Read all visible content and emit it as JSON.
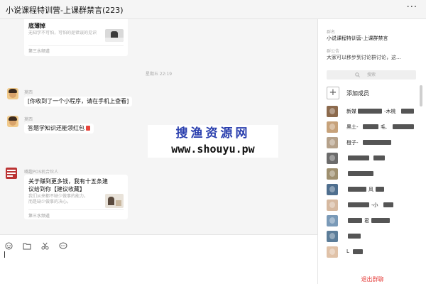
{
  "window": {
    "title": "小说课程特训营-上课群禁言(223)"
  },
  "chat": {
    "card1": {
      "title": "底薄掉",
      "desc": "无知学不可怕，可怕的是错误的见识",
      "source": "第三水频道"
    },
    "timestamp": "星期五 22:19",
    "messages": [
      {
        "sender": "莫西",
        "text": "[你收到了一个小程序，请在手机上查看]"
      },
      {
        "sender": "莫西",
        "text": "答题学知识还能领红包"
      }
    ],
    "card2": {
      "sender": "嘴趣POS机合伙人",
      "title_line1": "关于赚到更多钱，我有十五条建",
      "title_line2": "议给到你【建议收藏】",
      "desc_line1": "我们从来都不缺少做事的能力，",
      "desc_line2": "而是缺少做事的决心。",
      "source": "第三水频道"
    },
    "watermark": {
      "line1": "搜渔资源网",
      "line2": "www.shouyu.pw"
    }
  },
  "toolbar": {
    "emoji_icon": "smile-icon",
    "file_icon": "folder-icon",
    "screenshot_icon": "scissors-icon",
    "chat_icon": "speech-bubble-icon"
  },
  "sidebar": {
    "group_name_label": "群名",
    "group_name": "小说课程特训营-上课群禁言",
    "announcement_label": "群公告",
    "announcement": "大家可以移步到讨论群讨论，这...",
    "search_placeholder": "搜索",
    "add_member_label": "添加成员",
    "members": [
      {
        "name": "新媒",
        "suffix": "-木桃",
        "avatar_color": "#8c6a4d"
      },
      {
        "name": "黑土-",
        "suffix": "毛.",
        "avatar_color": "#c7a27a"
      },
      {
        "name": "橙子-",
        "suffix": "",
        "avatar_color": "#b5a18a"
      },
      {
        "name": "",
        "suffix": "",
        "avatar_color": "#6b6b6b"
      },
      {
        "name": "",
        "suffix": "",
        "avatar_color": "#9e8f6f"
      },
      {
        "name": "",
        "suffix": "风",
        "avatar_color": "#4f6f8f"
      },
      {
        "name": "",
        "suffix": "-小",
        "avatar_color": "#d6b9a0"
      },
      {
        "name": "",
        "suffix": "君",
        "avatar_color": "#7a9ab8"
      },
      {
        "name": "",
        "suffix": "",
        "avatar_color": "#5c7d99"
      },
      {
        "name": "L",
        "suffix": "",
        "avatar_color": "#e0c2a8"
      }
    ],
    "footer_action": "退出群聊"
  },
  "colors": {
    "accent_red": "#e64340",
    "watermark_blue": "#2a3fae"
  }
}
